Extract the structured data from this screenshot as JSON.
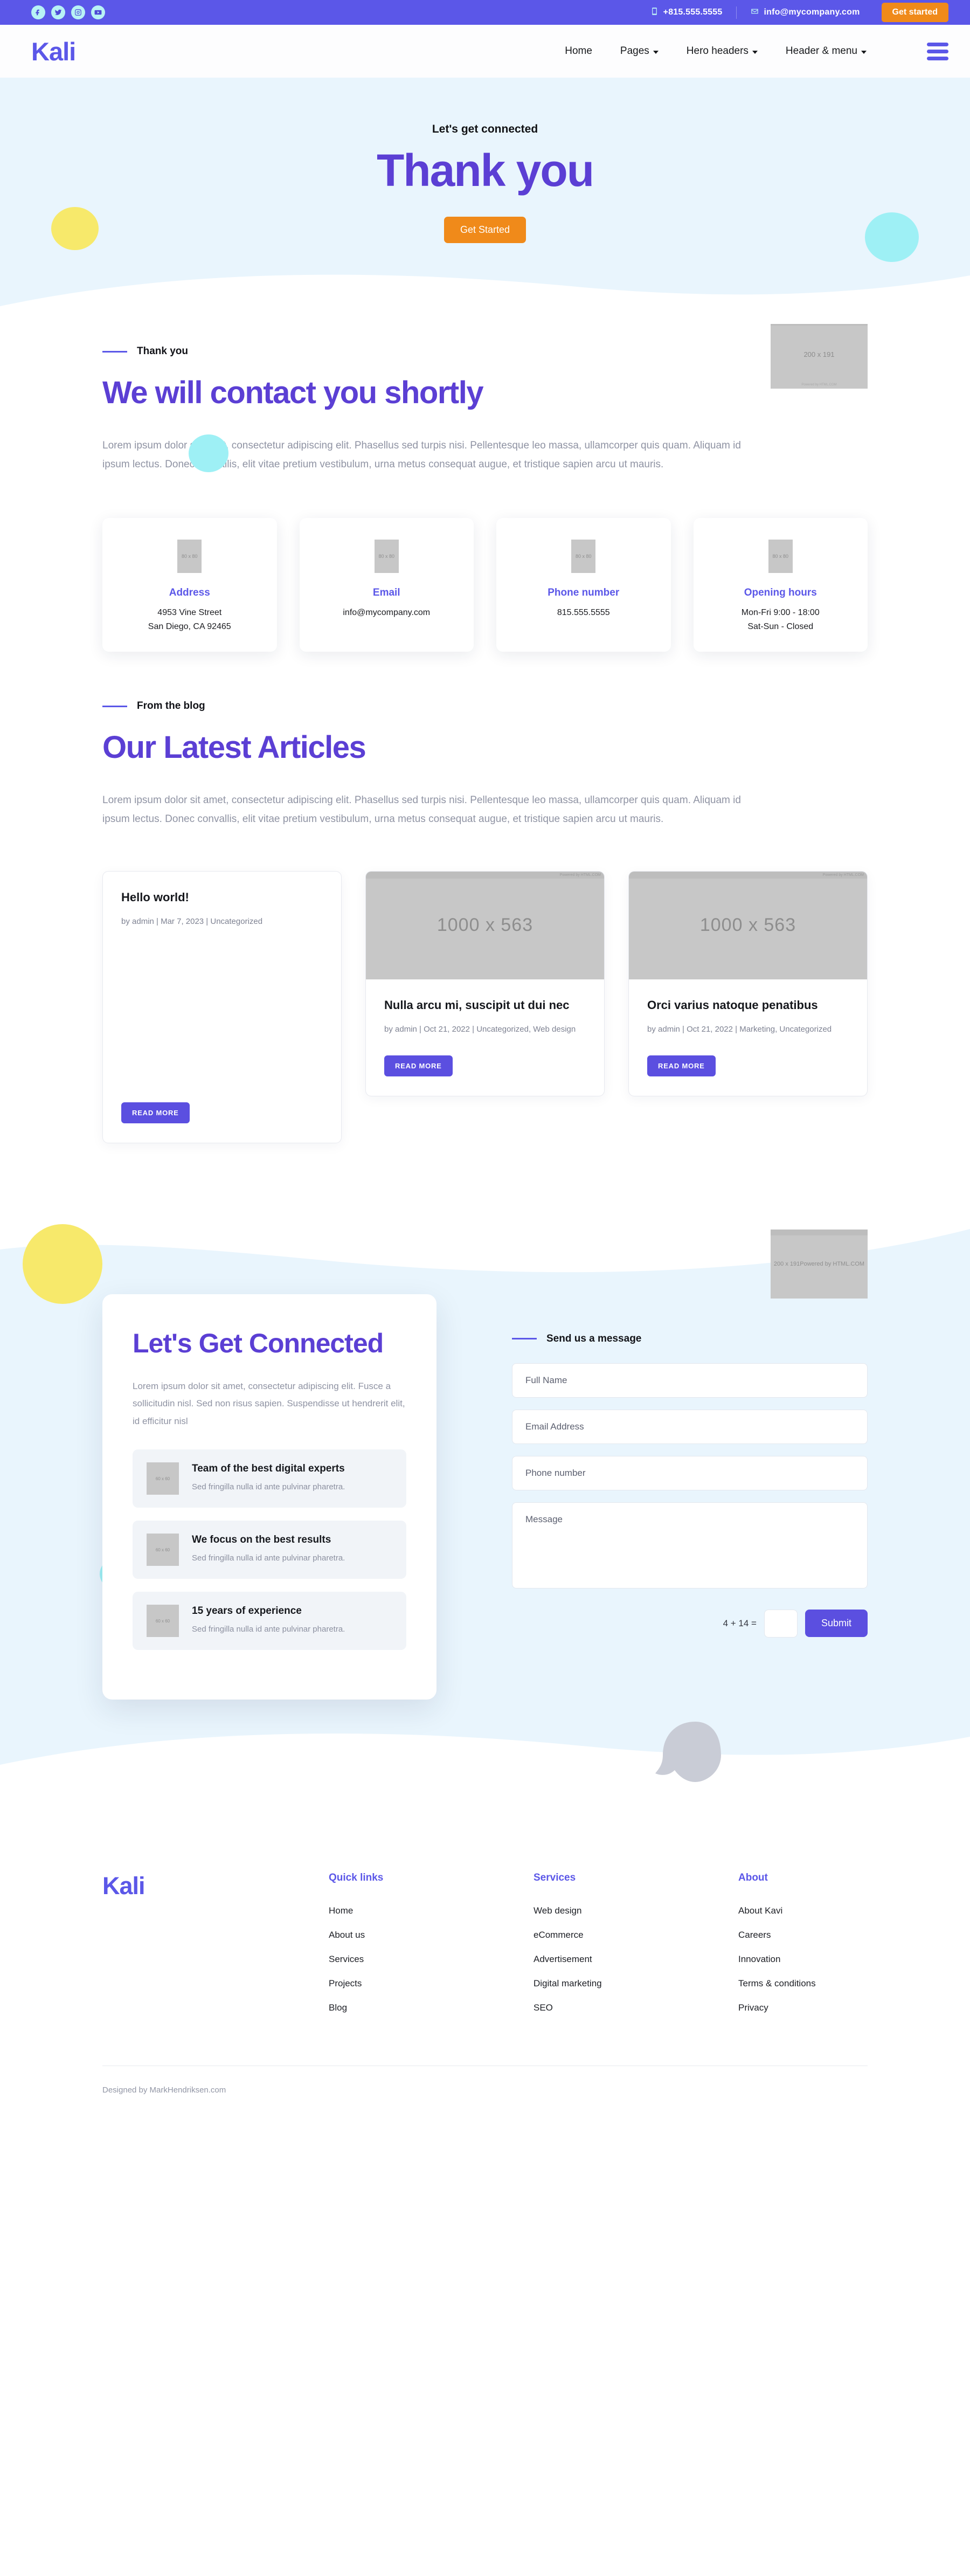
{
  "topbar": {
    "social": [
      {
        "name": "facebook-icon",
        "glyph": "f"
      },
      {
        "name": "twitter-icon",
        "glyph": "t"
      },
      {
        "name": "instagram-icon",
        "glyph": "i"
      },
      {
        "name": "youtube-icon",
        "glyph": "y"
      }
    ],
    "phone": "+815.555.5555",
    "email": "info@mycompany.com",
    "cta": "Get started",
    "bg_color": "#5b57e8",
    "cta_color": "#f08a1a"
  },
  "nav": {
    "logo": "Kali",
    "links": [
      {
        "label": "Home",
        "caret": false
      },
      {
        "label": "Pages",
        "caret": true
      },
      {
        "label": "Hero headers",
        "caret": true
      },
      {
        "label": "Header & menu",
        "caret": true
      }
    ],
    "menu_icon": "hamburger-icon"
  },
  "hero": {
    "kicker": "Let's get connected",
    "title": "Thank you",
    "button": "Get Started",
    "bg_color": "#e9f5fd",
    "title_color": "#5b3fd4"
  },
  "contact_section": {
    "eyebrow": "Thank you",
    "heading": "We will contact you shortly",
    "paragraph": "Lorem ipsum dolor sit amet, consectetur adipiscing elit. Phasellus sed turpis nisi. Pellentesque leo massa, ullamcorper quis quam. Aliquam id ipsum lectus. Donec convallis, elit vitae pretium vestibulum, urna metus consequat augue, et tristique sapien arcu ut mauris.",
    "placeholder_label": "200 x 191",
    "placeholder_footer": "Powered by HTML.COM",
    "cards": [
      {
        "icon_label": "80 x 80",
        "title": "Address",
        "lines": [
          "4953 Vine Street",
          "San Diego, CA 92465"
        ]
      },
      {
        "icon_label": "80 x 80",
        "title": "Email",
        "lines": [
          "info@mycompany.com"
        ]
      },
      {
        "icon_label": "80 x 80",
        "title": "Phone number",
        "lines": [
          "815.555.5555"
        ]
      },
      {
        "icon_label": "80 x 80",
        "title": "Opening hours",
        "lines": [
          "Mon-Fri 9:00 - 18:00",
          "Sat-Sun - Closed"
        ]
      }
    ]
  },
  "blog_section": {
    "eyebrow": "From the blog",
    "heading": "Our Latest Articles",
    "paragraph": "Lorem ipsum dolor sit amet, consectetur adipiscing elit. Phasellus sed turpis nisi. Pellentesque leo massa, ullamcorper quis quam. Aliquam id ipsum lectus. Donec convallis, elit vitae pretium vestibulum, urna metus consequat augue, et tristique sapien arcu ut mauris.",
    "read_more": "READ MORE",
    "image_label": "1000 x 563",
    "image_bar": "Powered by HTML.COM",
    "posts": [
      {
        "title": "Hello world!",
        "meta": "by admin | Mar 7, 2023 | Uncategorized",
        "has_image": false
      },
      {
        "title": "Nulla arcu mi, suscipit ut dui nec",
        "meta": "by admin | Oct 21, 2022 | Uncategorized, Web design",
        "has_image": true
      },
      {
        "title": "Orci varius natoque penatibus",
        "meta": "by admin | Oct 21, 2022 | Marketing, Uncategorized",
        "has_image": true
      }
    ]
  },
  "connect_section": {
    "card_title": "Let's Get Connected",
    "card_copy": "Lorem ipsum dolor sit amet, consectetur adipiscing elit. Fusce a sollicitudin nisl. Sed non risus sapien. Suspendisse ut hendrerit elit, id efficitur nisl",
    "features": [
      {
        "icon_label": "60 x 60",
        "title": "Team of the best digital experts",
        "copy": "Sed fringilla nulla id ante pulvinar pharetra."
      },
      {
        "icon_label": "60 x 60",
        "title": "We focus on the best results",
        "copy": "Sed fringilla nulla id ante pulvinar pharetra."
      },
      {
        "icon_label": "60 x 60",
        "title": "15 years of experience",
        "copy": "Sed fringilla nulla id ante pulvinar pharetra."
      }
    ],
    "form_eyebrow": "Send us a message",
    "fields": [
      {
        "name": "full-name",
        "placeholder": "Full Name",
        "type": "text"
      },
      {
        "name": "email-address",
        "placeholder": "Email Address",
        "type": "text"
      },
      {
        "name": "phone-number",
        "placeholder": "Phone number",
        "type": "text"
      },
      {
        "name": "message",
        "placeholder": "Message",
        "type": "textarea"
      }
    ],
    "captcha_label": "4 + 14 =",
    "captcha_value": "",
    "submit": "Submit",
    "placeholder_label": "200 x 191",
    "placeholder_footer": "Powered by HTML.COM"
  },
  "footer": {
    "logo": "Kali",
    "columns": [
      {
        "head": "Quick links",
        "links": [
          "Home",
          "About us",
          "Services",
          "Projects",
          "Blog"
        ]
      },
      {
        "head": "Services",
        "links": [
          "Web design",
          "eCommerce",
          "Advertisement",
          "Digital marketing",
          "SEO"
        ]
      },
      {
        "head": "About",
        "links": [
          "About Kavi",
          "Careers",
          "Innovation",
          "Terms & conditions",
          "Privacy"
        ]
      }
    ],
    "credit": "Designed by MarkHendriksen.com"
  }
}
